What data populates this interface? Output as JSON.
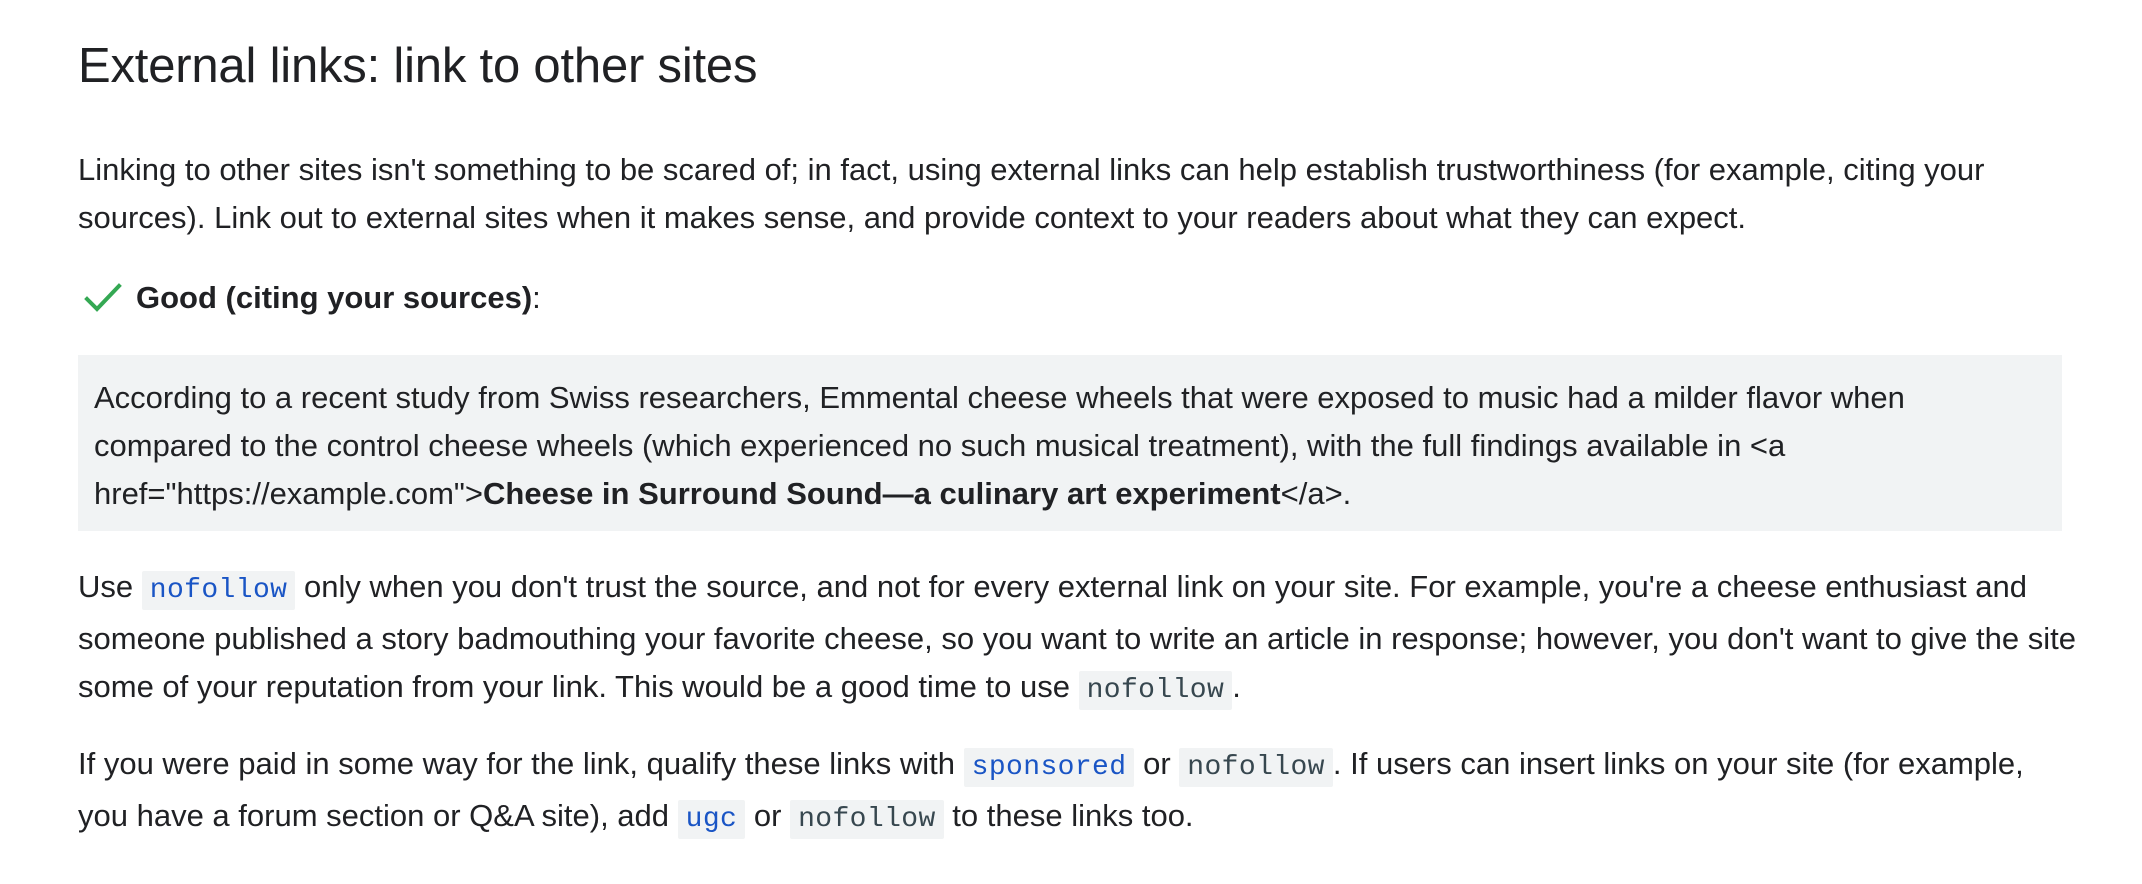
{
  "heading": "External links: link to other sites",
  "intro": "Linking to other sites isn't something to be scared of; in fact, using external links can help establish trustworthiness (for example, citing your sources). Link out to external sites when it makes sense, and provide context to your readers about what they can expect.",
  "good_label": {
    "icon": "check-icon",
    "bold": "Good (citing your sources)",
    "suffix": ":",
    "icon_color": "#34a853"
  },
  "example": {
    "text_before": "According to a recent study from Swiss researchers, Emmental cheese wheels that were exposed to music had a milder flavor when compared to the control cheese wheels (which experienced no such musical treatment), with the full findings available in <a href=\"https://example.com\">",
    "link_text": "Cheese in Surround Sound—a culinary art experiment",
    "text_after": "</a>."
  },
  "nofollow_paragraph": {
    "part1": "Use ",
    "code1": "nofollow",
    "part2": " only when you don't trust the source, and not for every external link on your site. For example, you're a cheese enthusiast and someone published a story badmouthing your favorite cheese, so you want to write an article in response; however, you don't want to give the site some of your reputation from your link. This would be a good time to use ",
    "code2": "nofollow",
    "part3": "."
  },
  "paid_paragraph": {
    "part1": "If you were paid in some way for the link, qualify these links with ",
    "code1": "sponsored",
    "part2": " or ",
    "code2": "nofollow",
    "part3": ". If users can insert links on your site (for example, you have a forum section or Q&A site), add ",
    "code3": "ugc",
    "part4": " or ",
    "code4": "nofollow",
    "part5": " to these links too."
  },
  "colors": {
    "text": "#202124",
    "code_bg": "#f1f3f4",
    "code_link": "#1a55c5",
    "code_plain": "#37474f",
    "check": "#34a853"
  }
}
